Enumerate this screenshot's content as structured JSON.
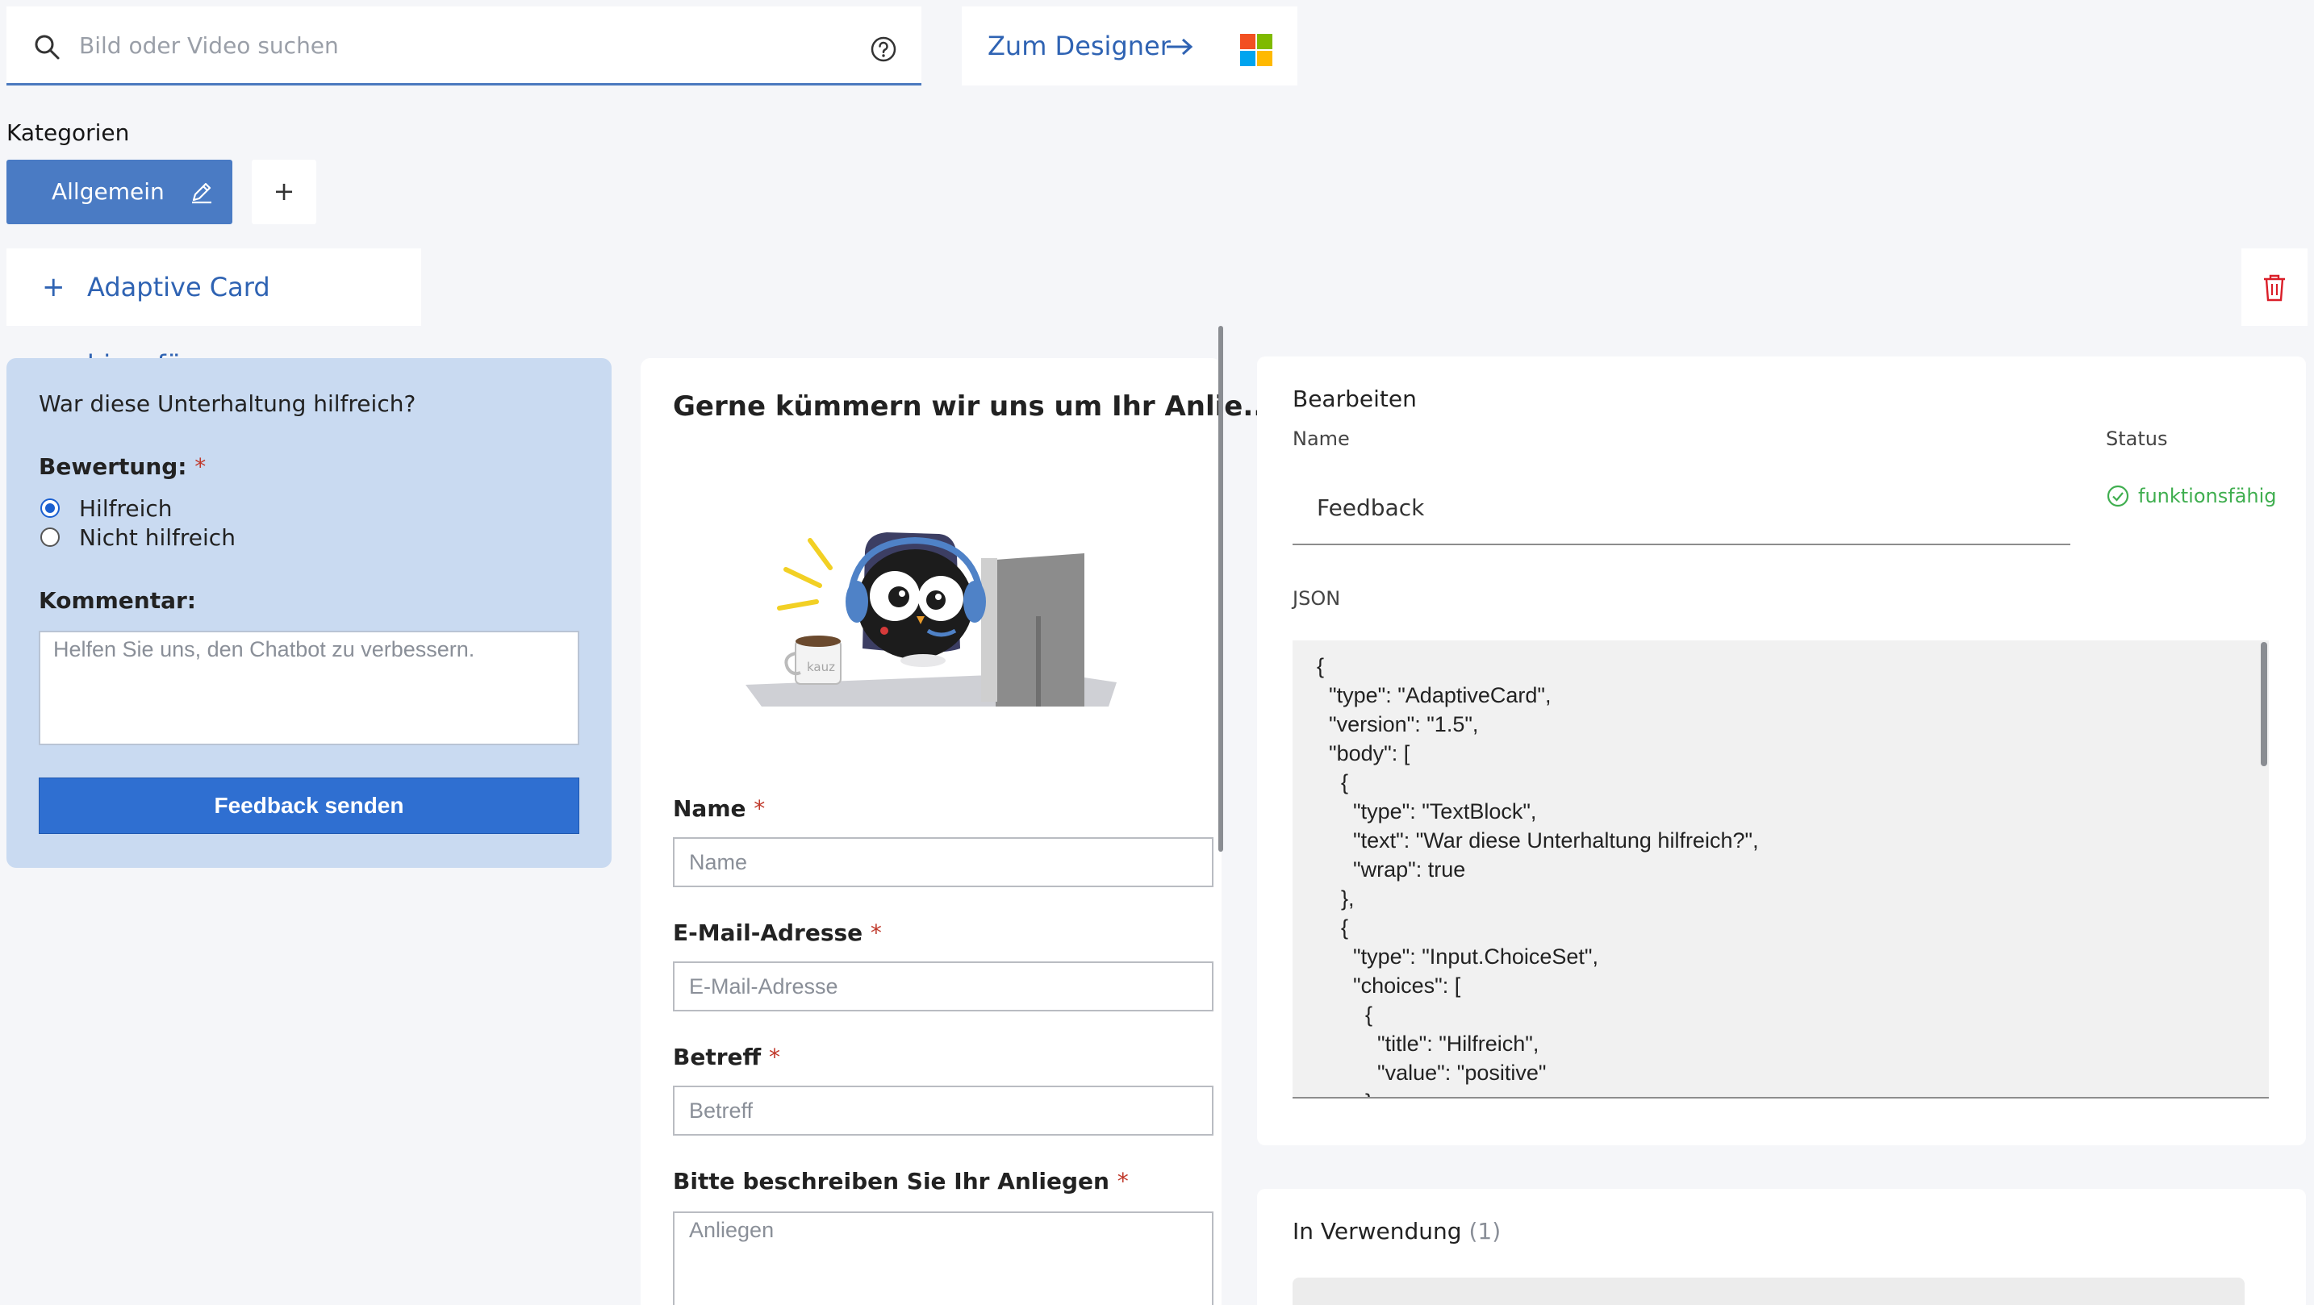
{
  "search": {
    "placeholder": "Bild oder Video suchen",
    "icon": "search-icon",
    "help_icon": "help-icon"
  },
  "designer": {
    "label": "Zum Designer",
    "arrow_icon": "arrow-right-icon",
    "logo": "microsoft-logo"
  },
  "categories": {
    "title": "Kategorien",
    "items": [
      {
        "label": "Allgemein"
      }
    ],
    "add_label": "+"
  },
  "toolbar": {
    "add_card_plus": "+",
    "add_card_label": "Adaptive Card hinzufügen",
    "delete_icon": "trash-icon"
  },
  "feedback_card": {
    "question": "War diese Unterhaltung hilfreich?",
    "rating_label": "Bewertung:",
    "required_mark": "*",
    "options": [
      {
        "label": "Hilfreich",
        "selected": true
      },
      {
        "label": "Nicht hilfreich",
        "selected": false
      }
    ],
    "comment_label": "Kommentar:",
    "comment_placeholder": "Helfen Sie uns, den Chatbot zu verbessern.",
    "submit_label": "Feedback senden"
  },
  "contact_card": {
    "title": "Gerne kümmern wir uns um Ihr Anlie...",
    "illustration_text": "kauz",
    "fields": [
      {
        "label": "Name",
        "required": "*",
        "placeholder": "Name"
      },
      {
        "label": "E-Mail-Adresse",
        "required": "*",
        "placeholder": "E-Mail-Adresse"
      },
      {
        "label": "Betreff",
        "required": "*",
        "placeholder": "Betreff"
      },
      {
        "label": "Bitte beschreiben Sie Ihr Anliegen",
        "required": "*",
        "placeholder": "Anliegen"
      }
    ]
  },
  "edit_panel": {
    "title": "Bearbeiten",
    "name_label": "Name",
    "name_value": "Feedback",
    "status_label": "Status",
    "status_value": "funktionsfähig",
    "status_color": "#3fae4f",
    "json_label": "JSON",
    "json_lines": [
      "{",
      "  \"type\": \"AdaptiveCard\",",
      "  \"version\": \"1.5\",",
      "  \"body\": [",
      "    {",
      "      \"type\": \"TextBlock\",",
      "      \"text\": \"War diese Unterhaltung hilfreich?\",",
      "      \"wrap\": true",
      "    },",
      "    {",
      "      \"type\": \"Input.ChoiceSet\",",
      "      \"choices\": [",
      "        {",
      "          \"title\": \"Hilfreich\",",
      "          \"value\": \"positive\"",
      "        },"
    ]
  },
  "usage_panel": {
    "title": "In Verwendung",
    "count": "(1)"
  },
  "colors": {
    "accent": "#2f63b3",
    "chip": "#4a7bc4",
    "feedback_bg": "#c9daf1",
    "submit": "#2f6fd1",
    "danger": "#da1e28"
  }
}
